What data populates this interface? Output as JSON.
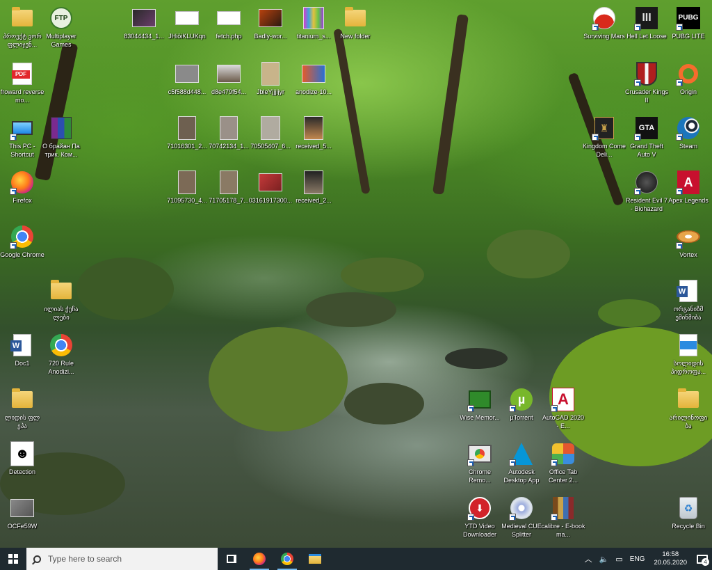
{
  "desktop": {
    "left_column": [
      {
        "label": "პროექტ ვორ ფლიჯენ...",
        "kind": "folder"
      },
      {
        "label": "froward reverse mo...",
        "kind": "pdf"
      },
      {
        "label": "This PC - Shortcut",
        "kind": "pc"
      },
      {
        "label": "Firefox",
        "kind": "firefox"
      },
      {
        "label": "Google Chrome",
        "kind": "chrome"
      },
      {
        "label": "Doc1",
        "kind": "word"
      },
      {
        "label": "ლიდის ფლ ეპა",
        "kind": "folder"
      },
      {
        "label": "Detection",
        "kind": "detect"
      },
      {
        "label": "OCFe59W",
        "kind": "photo"
      }
    ],
    "second_column": [
      {
        "label": "Multiplayer Games",
        "kind": "ftp"
      },
      {
        "label": "О брайан Па трик. Ком...",
        "kind": "rar"
      },
      {
        "label": "ილიას ქუჩა ლები",
        "kind": "folder"
      },
      {
        "label": "720 Rule Anodizi...",
        "kind": "chrome"
      }
    ],
    "top_row": [
      {
        "label": "83044434_1...",
        "kind": "photo"
      },
      {
        "label": "JHiöiKLUKqn",
        "kind": "doc"
      },
      {
        "label": "fetch.php",
        "kind": "doc"
      },
      {
        "label": "Badly-wor...",
        "kind": "photo"
      },
      {
        "label": "titanium_s...",
        "kind": "photo"
      },
      {
        "label": "New folder",
        "kind": "folder"
      }
    ],
    "grid_rows": [
      [
        {
          "label": "c5f588d448...",
          "kind": "photo"
        },
        {
          "label": "d8e479f54...",
          "kind": "photo"
        },
        {
          "label": "JbleYjjjijyr",
          "kind": "photo"
        },
        {
          "label": "anodize-10...",
          "kind": "photo"
        }
      ],
      [
        {
          "label": "71016301_2...",
          "kind": "photo"
        },
        {
          "label": "70742134_1...",
          "kind": "photo"
        },
        {
          "label": "70505407_6...",
          "kind": "photo"
        },
        {
          "label": "received_5...",
          "kind": "photo"
        }
      ],
      [
        {
          "label": "71095730_4...",
          "kind": "photo"
        },
        {
          "label": "71705178_7...",
          "kind": "photo"
        },
        {
          "label": "03161917300...",
          "kind": "photo"
        },
        {
          "label": "received_2...",
          "kind": "photo"
        }
      ]
    ],
    "right_top": [
      {
        "label": "Surviving Mars",
        "kind": "game"
      },
      {
        "label": "Hell Let Loose",
        "kind": "game"
      },
      {
        "label": "PUBG LITE",
        "kind": "pubg"
      }
    ],
    "right_side": [
      {
        "label": "Crusader Kings II",
        "kind": "game"
      },
      {
        "label": "Origin",
        "kind": "origin"
      },
      {
        "label": "Kingdom Come Deli...",
        "kind": "game"
      },
      {
        "label": "Grand Theft Auto V",
        "kind": "game"
      },
      {
        "label": "Steam",
        "kind": "steam"
      },
      {
        "label": "Resident Evil 7 - Biohazard",
        "kind": "game"
      },
      {
        "label": "Apex Legends",
        "kind": "apex"
      },
      {
        "label": "Vortex",
        "kind": "vortex"
      },
      {
        "label": "ორგანიზმ ემინმიბა",
        "kind": "word"
      },
      {
        "label": "სოლიდის პიდროფა...",
        "kind": "doc"
      },
      {
        "label": "არილინოფი ბა",
        "kind": "folder"
      },
      {
        "label": "Recycle Bin",
        "kind": "bin"
      }
    ],
    "bottom_cluster": [
      {
        "label": "Wise Memor...",
        "kind": "wise"
      },
      {
        "label": "µTorrent",
        "kind": "utorrent"
      },
      {
        "label": "AutoCAD 2020 - E...",
        "kind": "autocad"
      },
      {
        "label": "Chrome Remo...",
        "kind": "chrome-remote"
      },
      {
        "label": "Autodesk Desktop App",
        "kind": "autodesk"
      },
      {
        "label": "Office Tab Center 2...",
        "kind": "office"
      },
      {
        "label": "YTD Video Downloader",
        "kind": "ytd"
      },
      {
        "label": "Medieval CUE Splitter",
        "kind": "cue"
      },
      {
        "label": "calibre - E-book ma...",
        "kind": "calibre"
      }
    ]
  },
  "taskbar": {
    "search_placeholder": "Type here to search",
    "language": "ENG",
    "time": "16:58",
    "date": "20.05.2020",
    "notifications": "4"
  },
  "colors": {
    "taskbar_bg": "#1f2a30",
    "accent": "#76b9ed"
  }
}
